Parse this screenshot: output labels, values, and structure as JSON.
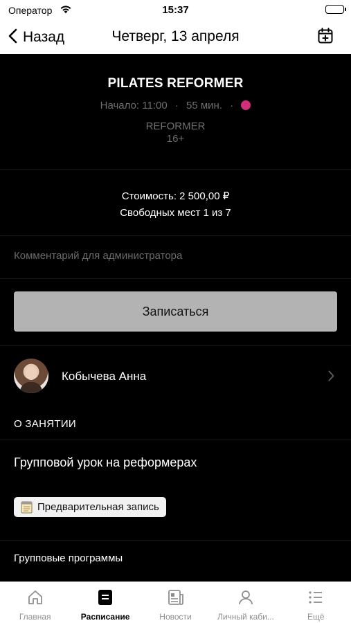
{
  "status_bar": {
    "carrier": "Оператор",
    "time": "15:37"
  },
  "nav": {
    "back_label": "Назад",
    "title": "Четверг, 13 апреля"
  },
  "class_info": {
    "title": "PILATES REFORMER",
    "start": "Начало: 11:00",
    "separator": "·",
    "duration": "55 мин.",
    "accent_color": "#d22e7a",
    "zone": "REFORMER",
    "age": "16+"
  },
  "booking": {
    "price": "Стоимость: 2 500,00 ₽",
    "seats": "Свободных мест 1 из 7",
    "comment_placeholder": "Комментарий для администратора",
    "signup_label": "Записаться"
  },
  "trainer": {
    "name": "Кобычева Анна"
  },
  "about": {
    "header": "О ЗАНЯТИИ",
    "lesson_name": "Групповой урок на реформерах",
    "badge_label": "Предварительная запись",
    "category": "Групповые программы"
  },
  "tabs": [
    {
      "label": "Главная",
      "icon": "home-icon"
    },
    {
      "label": "Расписание",
      "icon": "schedule-icon",
      "active": true
    },
    {
      "label": "Новости",
      "icon": "news-icon"
    },
    {
      "label": "Личный каби...",
      "icon": "profile-icon"
    },
    {
      "label": "Ещё",
      "icon": "more-icon"
    }
  ]
}
